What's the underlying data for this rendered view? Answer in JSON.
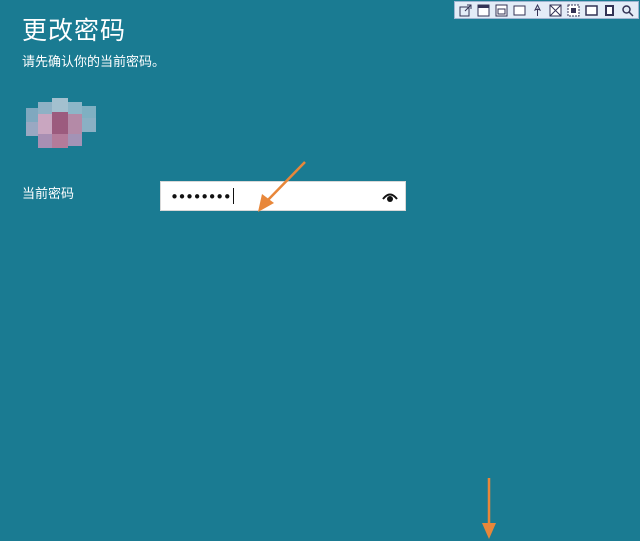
{
  "page": {
    "title": "更改密码",
    "subtitle": "请先确认你的当前密码。"
  },
  "form": {
    "current_password_label": "当前密码",
    "current_password_value": "••••••••"
  },
  "icons": {
    "reveal": "eye-icon",
    "avatar": "avatar-pixelated"
  },
  "toolbar": {
    "buttons": [
      "share-icon",
      "window-icon",
      "window-alt-icon",
      "rectangle-icon",
      "pin-icon",
      "crop-icon",
      "region-icon",
      "fullscreen-icon",
      "film-icon",
      "search-icon"
    ]
  },
  "colors": {
    "background": "#1a7b92",
    "annotation_arrow": "#e8873a"
  }
}
